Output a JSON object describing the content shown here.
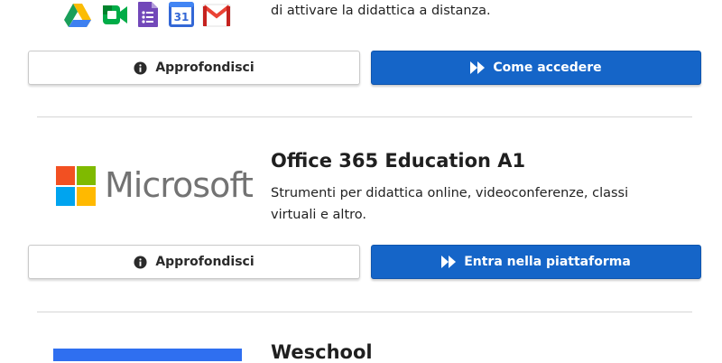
{
  "google": {
    "description_tail": "di attivare la didattica a distanza.",
    "more_label": "Approfondisci",
    "access_label": "Come accedere",
    "calendar_day": "31"
  },
  "microsoft": {
    "logo_text": "Microsoft",
    "title": "Office 365 Education A1",
    "description_line1": "Strumenti per didattica online, videoconferenze, classi",
    "description_line2": "virtuali e altro.",
    "more_label": "Approfondisci",
    "access_label": "Entra nella piattaforma"
  },
  "weschool": {
    "title": "Weschool"
  },
  "colors": {
    "primary_button": "#1565c8",
    "divider": "#d6d6d6",
    "ms_red": "#f25022",
    "ms_green": "#7fba00",
    "ms_blue": "#00a4ef",
    "ms_yellow": "#ffb900",
    "weschool_blue": "#2f6ff0"
  }
}
